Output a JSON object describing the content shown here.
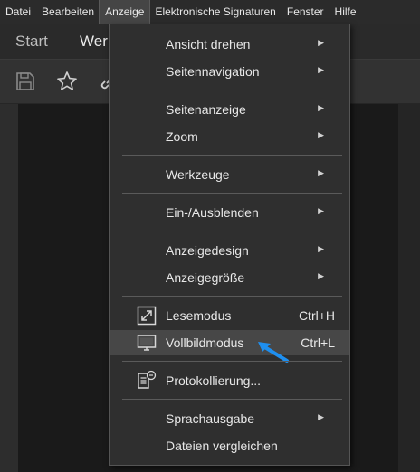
{
  "menubar": {
    "items": [
      {
        "label": "Datei"
      },
      {
        "label": "Bearbeiten"
      },
      {
        "label": "Anzeige"
      },
      {
        "label": "Elektronische Signaturen"
      },
      {
        "label": "Fenster"
      },
      {
        "label": "Hilfe"
      }
    ]
  },
  "tabs": {
    "start": "Start",
    "werk": "Werk"
  },
  "toolbar": {
    "icons": [
      "save-icon",
      "star-icon",
      "link-icon"
    ]
  },
  "view_menu": {
    "items": {
      "ansicht_drehen": "Ansicht drehen",
      "seitennavigation": "Seitennavigation",
      "seitenanzeige": "Seitenanzeige",
      "zoom": "Zoom",
      "werkzeuge": "Werkzeuge",
      "ein_ausblenden": "Ein-/Ausblenden",
      "anzeigedesign": "Anzeigedesign",
      "anzeigegroesse": "Anzeigegröße",
      "lesemodus": "Lesemodus",
      "lesemodus_shortcut": "Ctrl+H",
      "vollbildmodus": "Vollbildmodus",
      "vollbildmodus_shortcut": "Ctrl+L",
      "protokollierung": "Protokollierung...",
      "sprachausgabe": "Sprachausgabe",
      "dateien_vergleichen": "Dateien vergleichen"
    },
    "highlighted": "vollbildmodus"
  },
  "colors": {
    "menu_bg": "#2f2f2f",
    "highlight_bg": "#474747",
    "pointer_arrow": "#1e8ff0"
  }
}
